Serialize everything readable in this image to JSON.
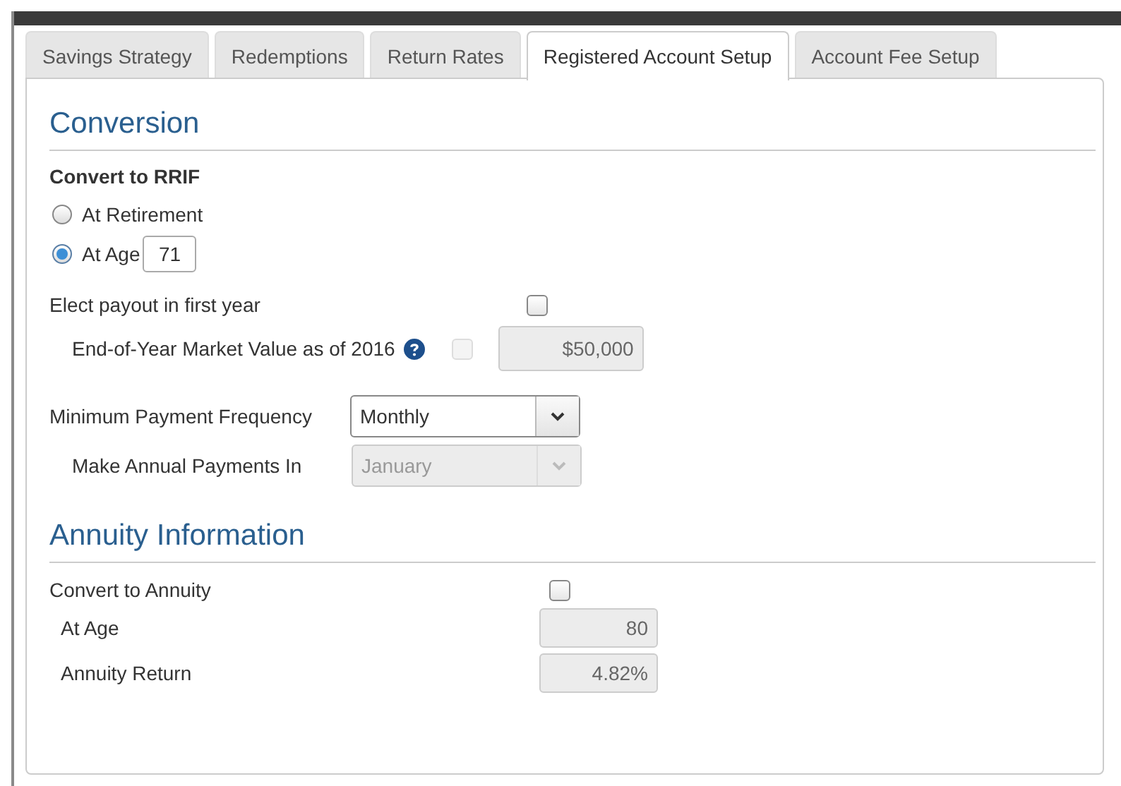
{
  "tabs": [
    {
      "label": "Savings Strategy",
      "selected": false
    },
    {
      "label": "Redemptions",
      "selected": false
    },
    {
      "label": "Return Rates",
      "selected": false
    },
    {
      "label": "Registered Account Setup",
      "selected": true
    },
    {
      "label": "Account Fee Setup",
      "selected": false
    }
  ],
  "conversion": {
    "title": "Conversion",
    "group_label": "Convert to RRIF",
    "options": [
      {
        "kind": "plain",
        "label": "At Retirement",
        "selected": false
      },
      {
        "kind": "age",
        "label": "At Age",
        "value": "71",
        "selected": true
      }
    ],
    "elect_payout": {
      "label": "Elect payout in first year",
      "checked": false
    },
    "market_value": {
      "label": "End-of-Year Market Value as of 2016",
      "checked": false,
      "disabled": true,
      "value": "$50,000"
    },
    "frequency": {
      "label": "Minimum Payment Frequency",
      "value": "Monthly",
      "disabled": false
    },
    "annual_payments": {
      "label": "Make Annual Payments In",
      "value": "January",
      "disabled": true
    }
  },
  "annuity": {
    "title": "Annuity Information",
    "convert": {
      "label": "Convert to Annuity",
      "checked": false
    },
    "at_age": {
      "label": "At Age",
      "value": "80",
      "disabled": true
    },
    "annuity_return": {
      "label": "Annuity Return",
      "value": "4.82%",
      "disabled": true
    }
  }
}
